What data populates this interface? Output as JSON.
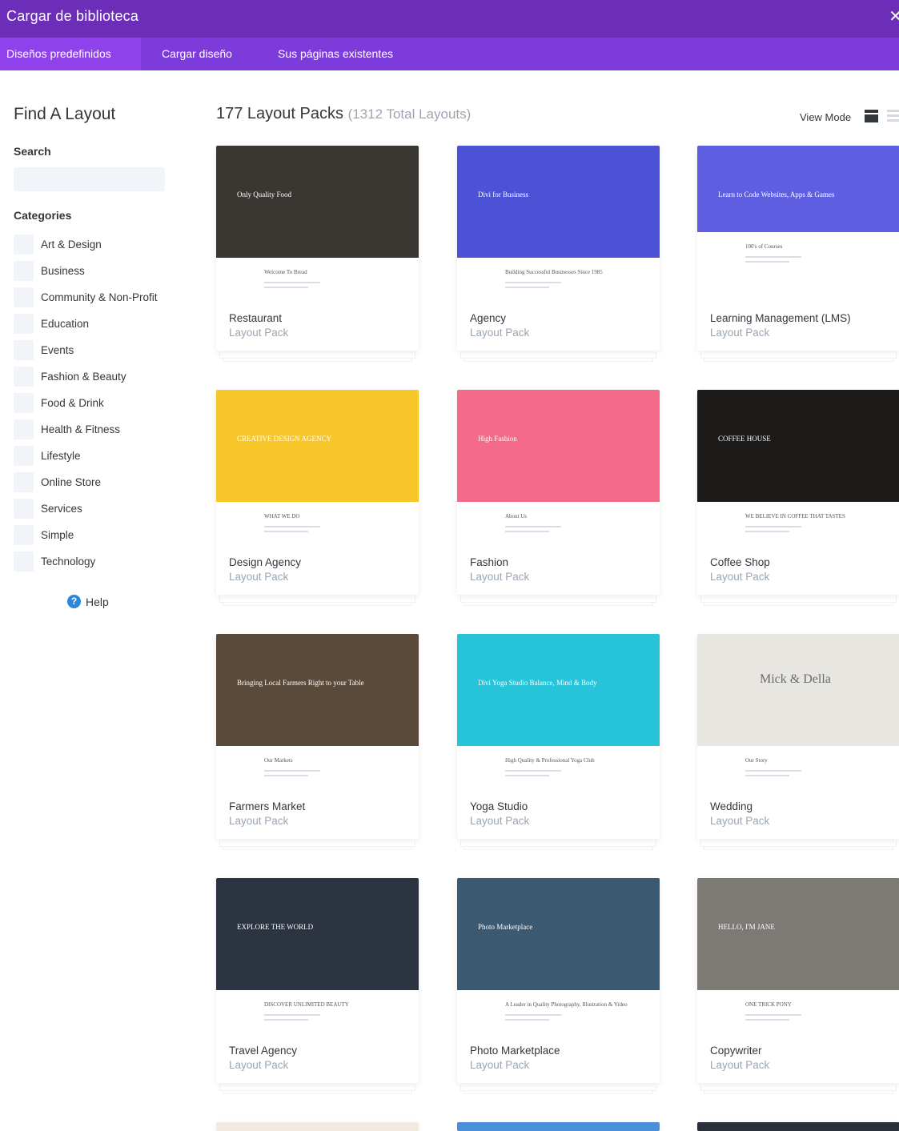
{
  "window": {
    "title": "Cargar de biblioteca",
    "close_icon": "close-icon"
  },
  "tabs": [
    {
      "label": "Diseños predefinidos",
      "active": true
    },
    {
      "label": "Cargar diseño",
      "active": false
    },
    {
      "label": "Sus páginas existentes",
      "active": false
    }
  ],
  "sidebar": {
    "title": "Find A Layout",
    "search_label": "Search",
    "search_placeholder": "",
    "categories_label": "Categories",
    "categories": [
      "Art & Design",
      "Business",
      "Community & Non-Profit",
      "Education",
      "Events",
      "Fashion & Beauty",
      "Food & Drink",
      "Health & Fitness",
      "Lifestyle",
      "Online Store",
      "Services",
      "Simple",
      "Technology"
    ],
    "help_label": "Help"
  },
  "main": {
    "count_title": "177 Layout Packs",
    "total_sub": "(1312 Total Layouts)",
    "view_mode_label": "View Mode"
  },
  "layouts": [
    {
      "name": "Restaurant",
      "kind": "Layout Pack",
      "hero_color": "#3a3733",
      "hero_text": "Only Quality Food",
      "lower_text": "Welcome To Bread"
    },
    {
      "name": "Agency",
      "kind": "Layout Pack",
      "hero_color": "#4b52d6",
      "hero_text": "Divi for Business",
      "lower_text": "Building Successful Businesses Since 1985"
    },
    {
      "name": "Learning Management (LMS)",
      "kind": "Layout Pack",
      "hero_color": "#5d5fe0",
      "hero_text": "Learn to Code Websites, Apps & Games",
      "lower_text": "100's of Courses"
    },
    {
      "name": "Design Agency",
      "kind": "Layout Pack",
      "hero_color": "#f7c72a",
      "hero_text": "CREATIVE DESIGN AGENCY",
      "lower_text": "WHAT WE DO"
    },
    {
      "name": "Fashion",
      "kind": "Layout Pack",
      "hero_color": "#f46b8a",
      "hero_text": "High Fashion",
      "lower_text": "About Us"
    },
    {
      "name": "Coffee Shop",
      "kind": "Layout Pack",
      "hero_color": "#1d1b1a",
      "hero_text": "COFFEE HOUSE",
      "lower_text": "WE BELIEVE IN COFFEE THAT TASTES"
    },
    {
      "name": "Farmers Market",
      "kind": "Layout Pack",
      "hero_color": "#5a4a3a",
      "hero_text": "Bringing Local Farmers Right to your Table",
      "lower_text": "Our Markets"
    },
    {
      "name": "Yoga Studio",
      "kind": "Layout Pack",
      "hero_color": "#27c4d9",
      "hero_text": "Divi Yoga Studio Balance, Mind & Body",
      "lower_text": "High Quality & Professional Yoga Club"
    },
    {
      "name": "Wedding",
      "kind": "Layout Pack",
      "hero_color": "#e8e6e1",
      "hero_text": "Mick & Della",
      "lower_text": "Our Story"
    },
    {
      "name": "Travel Agency",
      "kind": "Layout Pack",
      "hero_color": "#2b3440",
      "hero_text": "EXPLORE THE WORLD",
      "lower_text": "DISCOVER UNLIMITED BEAUTY"
    },
    {
      "name": "Photo Marketplace",
      "kind": "Layout Pack",
      "hero_color": "#3b5a72",
      "hero_text": "Photo Marketplace",
      "lower_text": "A Leader in Quality Photography, Illustration & Video"
    },
    {
      "name": "Copywriter",
      "kind": "Layout Pack",
      "hero_color": "#7d7a76",
      "hero_text": "HELLO, I'M JANE",
      "lower_text": "ONE TRICK PONY"
    }
  ]
}
